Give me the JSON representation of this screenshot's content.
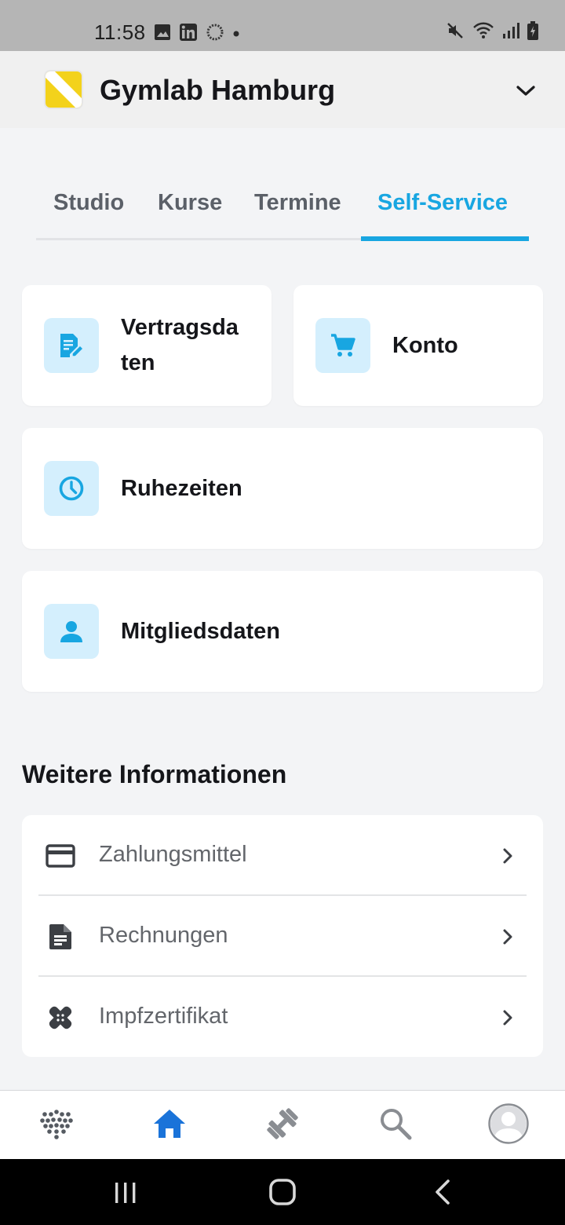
{
  "status_bar": {
    "time": "11:58",
    "left_icons": [
      "image-icon",
      "linkedin-icon",
      "loading-icon",
      "dot-icon"
    ],
    "right_icons": [
      "mute-icon",
      "wifi-icon",
      "signal-icon",
      "battery-icon"
    ]
  },
  "header": {
    "title": "Gymlab Hamburg",
    "logo": "gymlab-logo",
    "dropdown_icon": "chevron-down-icon"
  },
  "tabs": [
    {
      "label": "Studio",
      "active": false
    },
    {
      "label": "Kurse",
      "active": false
    },
    {
      "label": "Termine",
      "active": false
    },
    {
      "label": "Self-Service",
      "active": true
    }
  ],
  "cards": {
    "vertragsdaten": {
      "line1": "Vertragsda",
      "line2": "ten",
      "icon": "edit-document-icon"
    },
    "konto": {
      "label": "Konto",
      "icon": "cart-icon"
    },
    "ruhezeiten": {
      "label": "Ruhezeiten",
      "icon": "clock-icon"
    },
    "mitgliedsdaten": {
      "label": "Mitgliedsdaten",
      "icon": "person-icon"
    }
  },
  "more_info": {
    "title": "Weitere Informationen",
    "items": [
      {
        "label": "Zahlungsmittel",
        "icon": "credit-card-icon"
      },
      {
        "label": "Rechnungen",
        "icon": "document-icon"
      },
      {
        "label": "Impfzertifikat",
        "icon": "bandage-icon"
      }
    ]
  },
  "bottom_nav": [
    {
      "icon": "dots-grid-icon",
      "active": false
    },
    {
      "icon": "home-icon",
      "active": true
    },
    {
      "icon": "dumbbell-icon",
      "active": false
    },
    {
      "icon": "search-icon",
      "active": false
    },
    {
      "icon": "avatar-icon",
      "active": false
    }
  ],
  "colors": {
    "accent": "#18a6e1",
    "active_nav": "#1a73d9",
    "icon_box_bg": "#d4effd",
    "background": "#f3f4f6"
  }
}
